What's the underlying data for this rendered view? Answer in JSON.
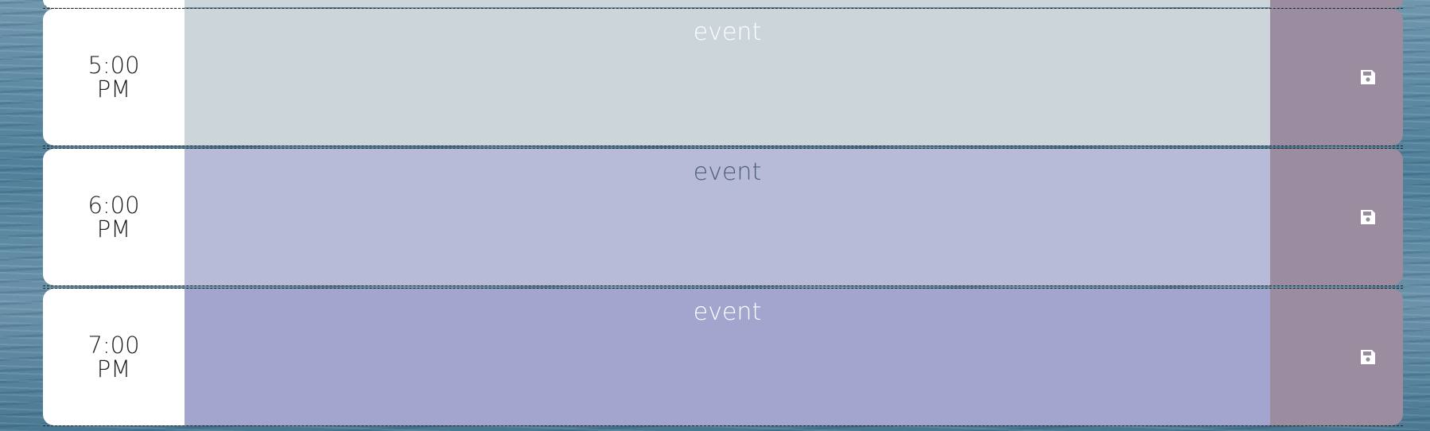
{
  "rows": [
    {
      "time_hour": "5:00",
      "time_period": "PM",
      "event_text": "event",
      "state": "past"
    },
    {
      "time_hour": "6:00",
      "time_period": "PM",
      "event_text": "event",
      "state": "present"
    },
    {
      "time_hour": "7:00",
      "time_period": "PM",
      "event_text": "event",
      "state": "future"
    }
  ],
  "icons": {
    "save": "floppy-disk-icon"
  },
  "colors": {
    "hour_bg": "#ffffff",
    "past": "#cbd5da",
    "present": "#b7bbd7",
    "future": "#a3a5ce",
    "save_bg": "#9b8c9f"
  }
}
